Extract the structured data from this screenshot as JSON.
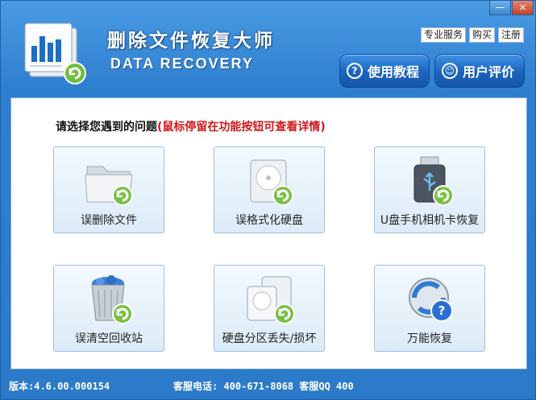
{
  "window": {
    "title": "删除文件恢复大师",
    "subtitle": "DATA RECOVERY",
    "minimize": "—",
    "close": "×"
  },
  "top_links": [
    "专业服务",
    "购买",
    "注册"
  ],
  "nav_buttons": [
    {
      "label": "使用教程",
      "icon": "question-icon"
    },
    {
      "label": "用户评价",
      "icon": "user-review-icon"
    }
  ],
  "prompt": {
    "main": "请选择您遇到的问题",
    "hint": "(鼠标停留在功能按钮可查看详情)"
  },
  "features": [
    {
      "label": "误删除文件",
      "icon": "folder-icon"
    },
    {
      "label": "误格式化硬盘",
      "icon": "hard-disk-icon"
    },
    {
      "label": "U盘手机相机卡恢复",
      "icon": "usb-drive-icon"
    },
    {
      "label": "误清空回收站",
      "icon": "recycle-bin-icon"
    },
    {
      "label": "硬盘分区丢失/损坏",
      "icon": "partition-icon"
    },
    {
      "label": "万能恢复",
      "icon": "universal-recovery-icon"
    }
  ],
  "footer": {
    "version": "版本:4.6.00.000154",
    "service": "客服电话: 400-671-8068 客服QQ 400"
  },
  "colors": {
    "accent": "#2f7fd0",
    "hint": "#d0161b",
    "card_bg": "#e6f1fb"
  }
}
